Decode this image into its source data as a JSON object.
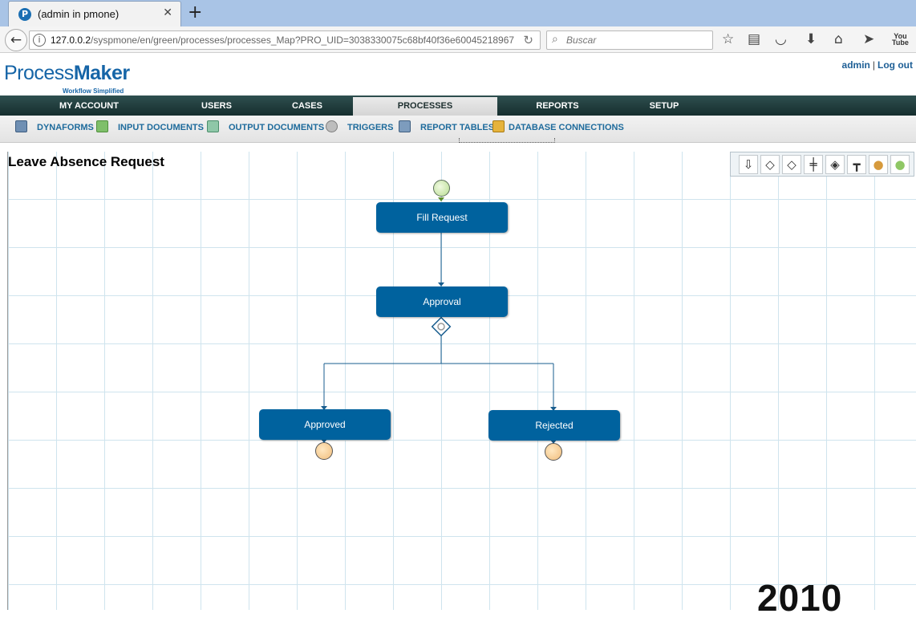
{
  "browser": {
    "tab_title": "(admin in pmone)",
    "url_host": "127.0.0.2",
    "url_path": "/syspmone/en/green/processes/processes_Map?PRO_UID=3038330075c68bf40f36e60045218967",
    "search_placeholder": "Buscar"
  },
  "header": {
    "logo_process": "Process",
    "logo_maker": "Maker",
    "logo_sub": "Workflow Simplified",
    "user_link": "admin",
    "separator": "|",
    "logout_link": "Log out"
  },
  "main_menu": [
    {
      "label": "MY ACCOUNT"
    },
    {
      "label": "USERS"
    },
    {
      "label": "CASES"
    },
    {
      "label": "PROCESSES",
      "active": true
    },
    {
      "label": "REPORTS"
    },
    {
      "label": "SETUP"
    }
  ],
  "sub_menu": [
    {
      "label": "DYNAFORMS",
      "icon": "form-icon"
    },
    {
      "label": "INPUT DOCUMENTS",
      "icon": "input-document-icon"
    },
    {
      "label": "OUTPUT DOCUMENTS",
      "icon": "output-document-icon"
    },
    {
      "label": "TRIGGERS",
      "icon": "gear-icon"
    },
    {
      "label": "REPORT TABLES",
      "icon": "table-icon"
    },
    {
      "label": "DATABASE CONNECTIONS",
      "icon": "connection-icon"
    }
  ],
  "process": {
    "title": "Leave Absence Request",
    "tasks": {
      "fill_request": "Fill Request",
      "approval": "Approval",
      "approved": "Approved",
      "rejected": "Rejected"
    }
  },
  "toolbar_tools": [
    "sequential-icon",
    "selection-icon",
    "evaluation-icon",
    "parallel-icon",
    "parallel-evaluation-icon",
    "end-of-process-icon",
    "end-event-icon",
    "start-event-icon"
  ],
  "colors": {
    "task_fill": "#00629e",
    "link_color": "#1e6b9c",
    "menu_bg": "#1f3b3b"
  },
  "watermark": "2010"
}
